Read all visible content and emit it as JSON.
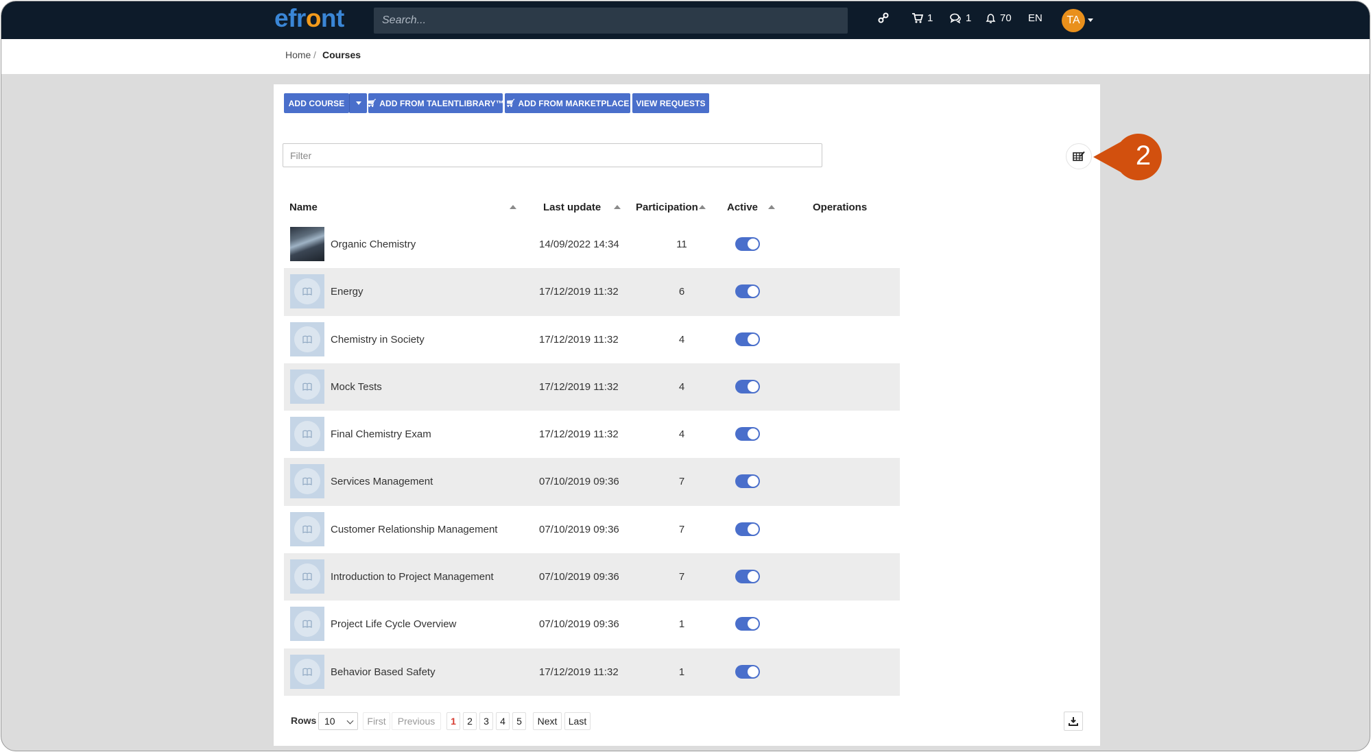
{
  "app": {
    "logo": {
      "pre": "efr",
      "o": "o",
      "post": "nt"
    },
    "search_placeholder": "Search...",
    "cart_count": "1",
    "messages_count": "1",
    "notifications_count": "70",
    "language": "EN",
    "avatar_initials": "TA",
    "brand_color": "#3a86d6",
    "accent_color": "#4a6fcb"
  },
  "breadcrumb": {
    "home": "Home",
    "separator": "/",
    "current": "Courses"
  },
  "toolbar": {
    "add_course": "ADD COURSE",
    "add_from_talentlibrary": "ADD FROM TALENTLIBRARY™",
    "add_from_marketplace": "ADD FROM MARKETPLACE",
    "view_requests": "VIEW REQUESTS"
  },
  "filter_placeholder": "Filter",
  "callout_number": "2",
  "table": {
    "headers": {
      "name": "Name",
      "last_update": "Last update",
      "participation": "Participation",
      "active": "Active",
      "operations": "Operations"
    },
    "rows": [
      {
        "name": "Organic Chemistry",
        "last_update": "14/09/2022 14:34",
        "participation": "11",
        "active": true
      },
      {
        "name": "Energy",
        "last_update": "17/12/2019 11:32",
        "participation": "6",
        "active": true
      },
      {
        "name": "Chemistry in Society",
        "last_update": "17/12/2019 11:32",
        "participation": "4",
        "active": true
      },
      {
        "name": "Mock Tests",
        "last_update": "17/12/2019 11:32",
        "participation": "4",
        "active": true
      },
      {
        "name": "Final Chemistry Exam",
        "last_update": "17/12/2019 11:32",
        "participation": "4",
        "active": true
      },
      {
        "name": "Services Management",
        "last_update": "07/10/2019 09:36",
        "participation": "7",
        "active": true
      },
      {
        "name": "Customer Relationship Management",
        "last_update": "07/10/2019 09:36",
        "participation": "7",
        "active": true
      },
      {
        "name": "Introduction to Project Management",
        "last_update": "07/10/2019 09:36",
        "participation": "7",
        "active": true
      },
      {
        "name": "Project Life Cycle Overview",
        "last_update": "07/10/2019 09:36",
        "participation": "1",
        "active": true
      },
      {
        "name": "Behavior Based Safety",
        "last_update": "17/12/2019 11:32",
        "participation": "1",
        "active": true
      }
    ]
  },
  "pagination": {
    "rows_label": "Rows",
    "rows_value": "10",
    "first": "First",
    "previous": "Previous",
    "pages": [
      "1",
      "2",
      "3",
      "4",
      "5"
    ],
    "current_page": "1",
    "next": "Next",
    "last": "Last"
  }
}
